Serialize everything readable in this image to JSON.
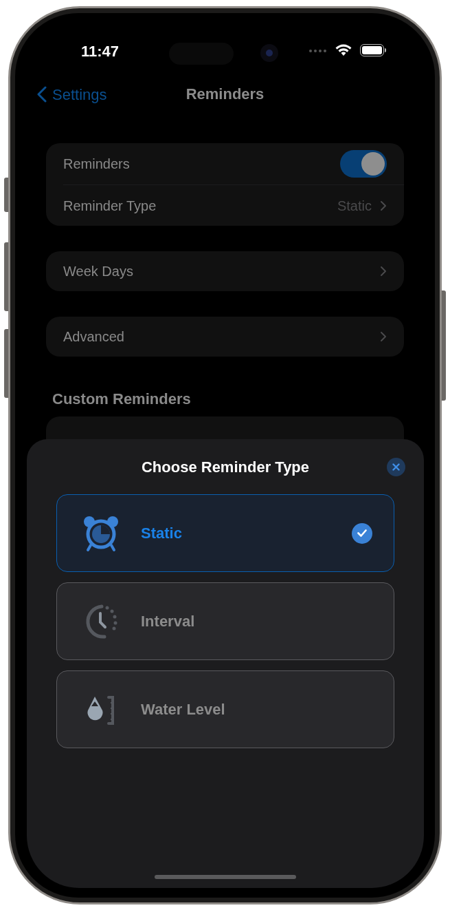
{
  "status_bar": {
    "time": "11:47"
  },
  "nav": {
    "back": "Settings",
    "title": "Reminders"
  },
  "groups": [
    {
      "rows": [
        {
          "kind": "toggle",
          "label": "Reminders",
          "on": true
        },
        {
          "kind": "link",
          "label": "Reminder Type",
          "value": "Static"
        }
      ]
    },
    {
      "rows": [
        {
          "kind": "link",
          "label": "Week Days"
        }
      ]
    },
    {
      "rows": [
        {
          "kind": "link",
          "label": "Advanced"
        }
      ]
    }
  ],
  "custom_section": {
    "title": "Custom Reminders"
  },
  "sheet": {
    "title": "Choose Reminder Type",
    "options": [
      {
        "kind": "alarm",
        "label": "Static",
        "selected": true
      },
      {
        "kind": "interval",
        "label": "Interval",
        "selected": false
      },
      {
        "kind": "water",
        "label": "Water Level",
        "selected": false
      }
    ]
  }
}
